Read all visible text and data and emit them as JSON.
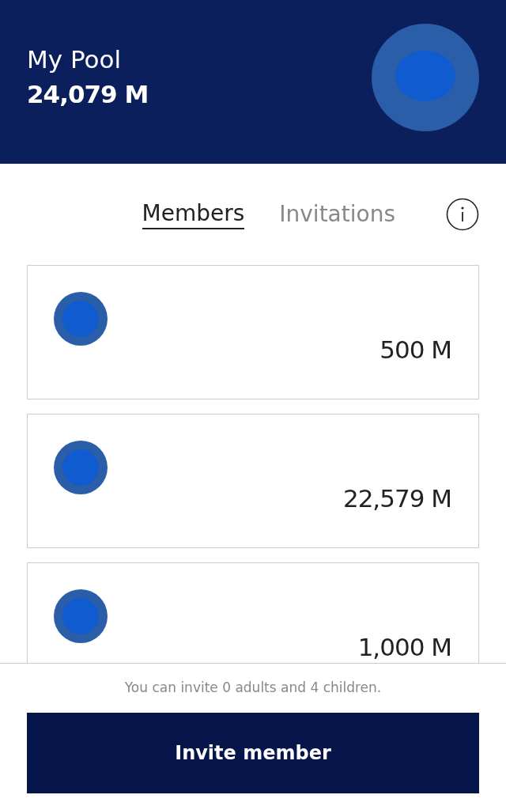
{
  "header": {
    "title": "My Pool",
    "balance": "24,079",
    "unit": "M"
  },
  "tabs": [
    {
      "label": "Members",
      "selected": true
    },
    {
      "label": "Invitations",
      "selected": false
    }
  ],
  "members": [
    {
      "amount": "500",
      "unit": "M"
    },
    {
      "amount": "22,579",
      "unit": "M"
    },
    {
      "amount": "1,000",
      "unit": "M"
    }
  ],
  "footer": {
    "note": "You can invite 0 adults and 4 children.",
    "button": "Invite member"
  }
}
